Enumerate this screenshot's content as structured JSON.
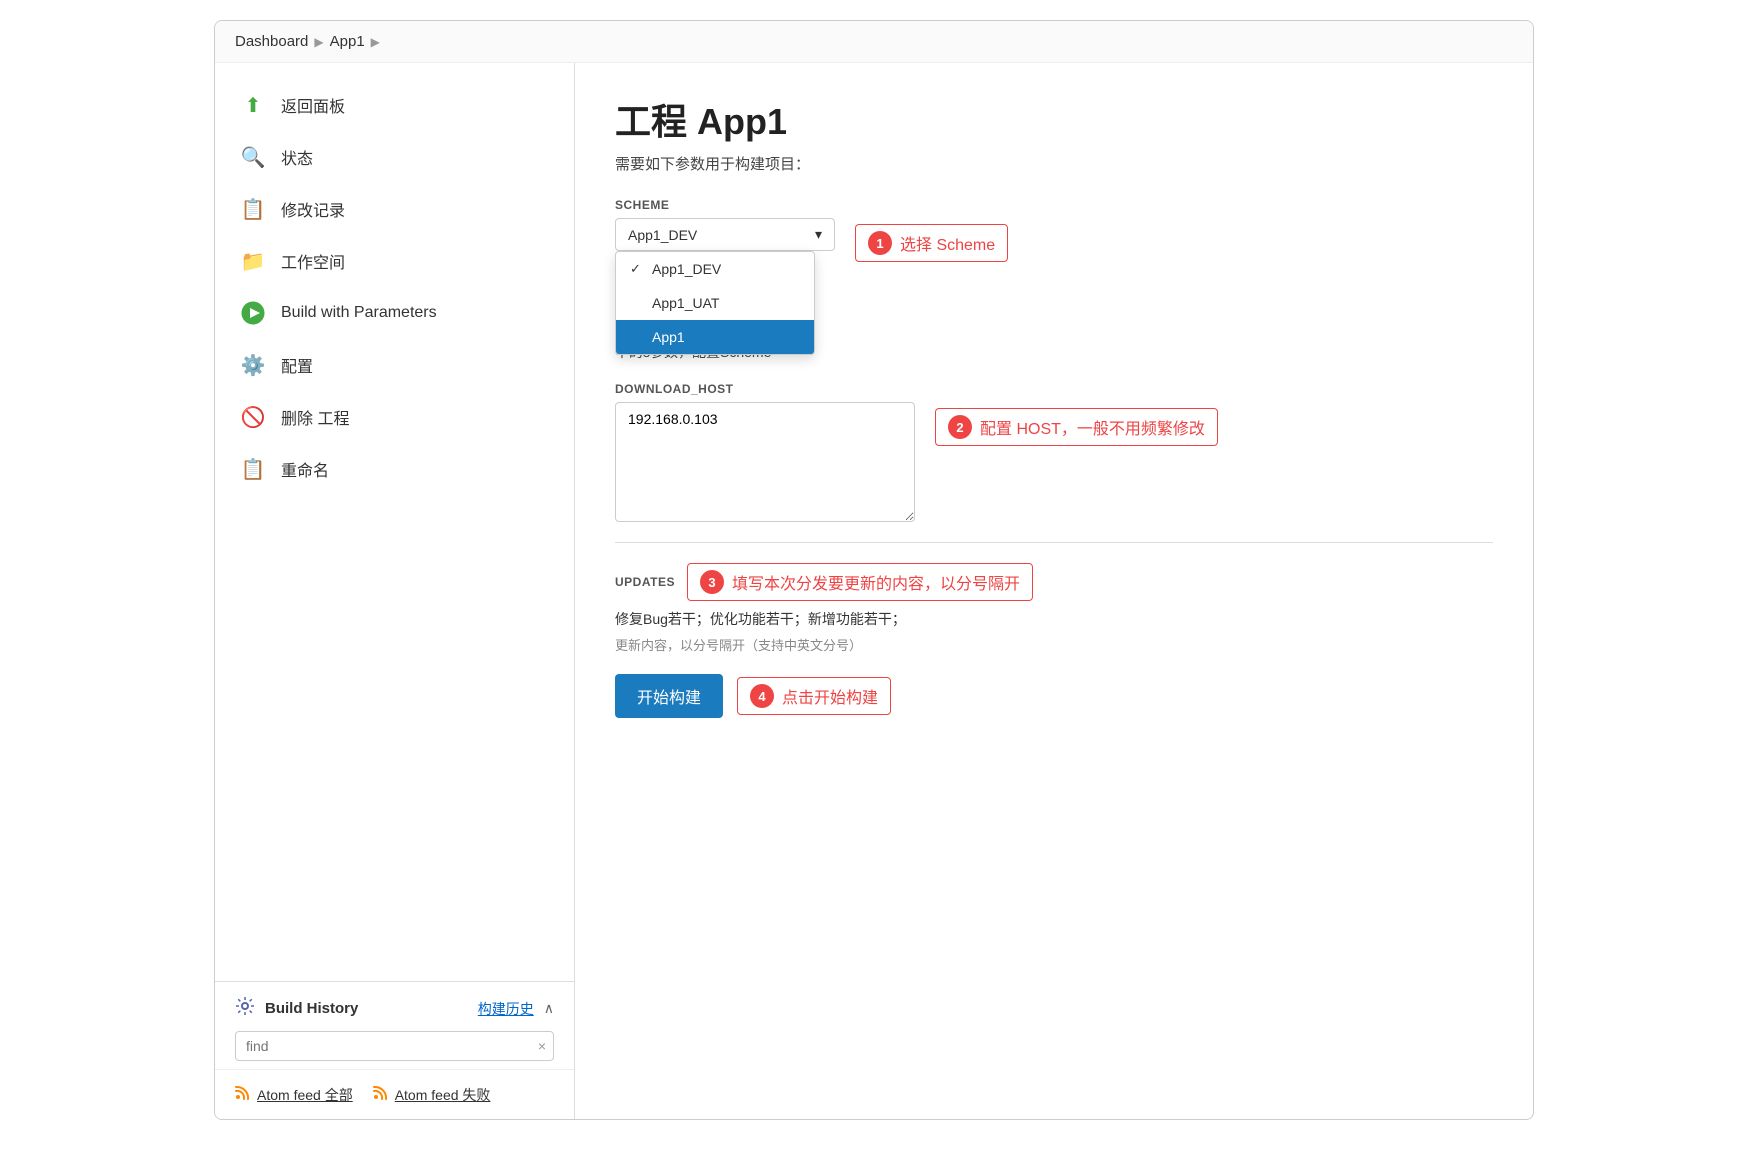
{
  "breadcrumb": {
    "items": [
      "Dashboard",
      "App1"
    ],
    "arrows": [
      "▶",
      "▶"
    ]
  },
  "sidebar": {
    "nav_items": [
      {
        "id": "back",
        "label": "返回面板",
        "icon": "⬆",
        "icon_color": "#4a4"
      },
      {
        "id": "status",
        "label": "状态",
        "icon": "🔍",
        "icon_color": "#666"
      },
      {
        "id": "changelog",
        "label": "修改记录",
        "icon": "📋",
        "icon_color": "#666"
      },
      {
        "id": "workspace",
        "label": "工作空间",
        "icon": "📁",
        "icon_color": "#666"
      },
      {
        "id": "build-with-params",
        "label": "Build with Parameters",
        "icon": "▶",
        "icon_color": "#4a4"
      },
      {
        "id": "config",
        "label": "配置",
        "icon": "⚙",
        "icon_color": "#888"
      },
      {
        "id": "delete",
        "label": "删除 工程",
        "icon": "🚫",
        "icon_color": "#e44"
      },
      {
        "id": "rename",
        "label": "重命名",
        "icon": "📋",
        "icon_color": "#666"
      }
    ],
    "build_history": {
      "title": "Build History",
      "title_cn": "构建历史",
      "chevron": "∧",
      "search_placeholder": "find",
      "search_clear": "×"
    },
    "atom_feed": {
      "all_label": "Atom feed 全部",
      "fail_label": "Atom feed 失败"
    }
  },
  "content": {
    "title": "工程 App1",
    "subtitle": "需要如下参数用于构建项目：",
    "scheme_label": "SCHEME",
    "scheme_dropdown_value": "App1_DEV",
    "scheme_options": [
      {
        "label": "App1_DEV",
        "checked": true,
        "selected": false
      },
      {
        "label": "App1_UAT",
        "checked": false,
        "selected": false
      },
      {
        "label": "App1",
        "checked": false,
        "selected": true
      }
    ],
    "scheme_callout_number": "1",
    "scheme_callout_text": "选择 Scheme",
    "scheme_description": "中的s参数，配置Scheme",
    "download_host_label": "DOWNLOAD_HOST",
    "download_host_value": "192.168.0.103",
    "host_callout_number": "2",
    "host_callout_text": "配置 HOST，一般不用频繁修改",
    "updates_label": "UPDATES",
    "updates_callout_number": "3",
    "updates_callout_text": "填写本次分发要更新的内容，以分号隔开",
    "updates_value": "修复Bug若干；优化功能若干；新增功能若干；",
    "updates_hint": "更新内容，以分号隔开（支持中英文分号）",
    "build_button_label": "开始构建",
    "build_callout_number": "4",
    "build_callout_text": "点击开始构建"
  }
}
